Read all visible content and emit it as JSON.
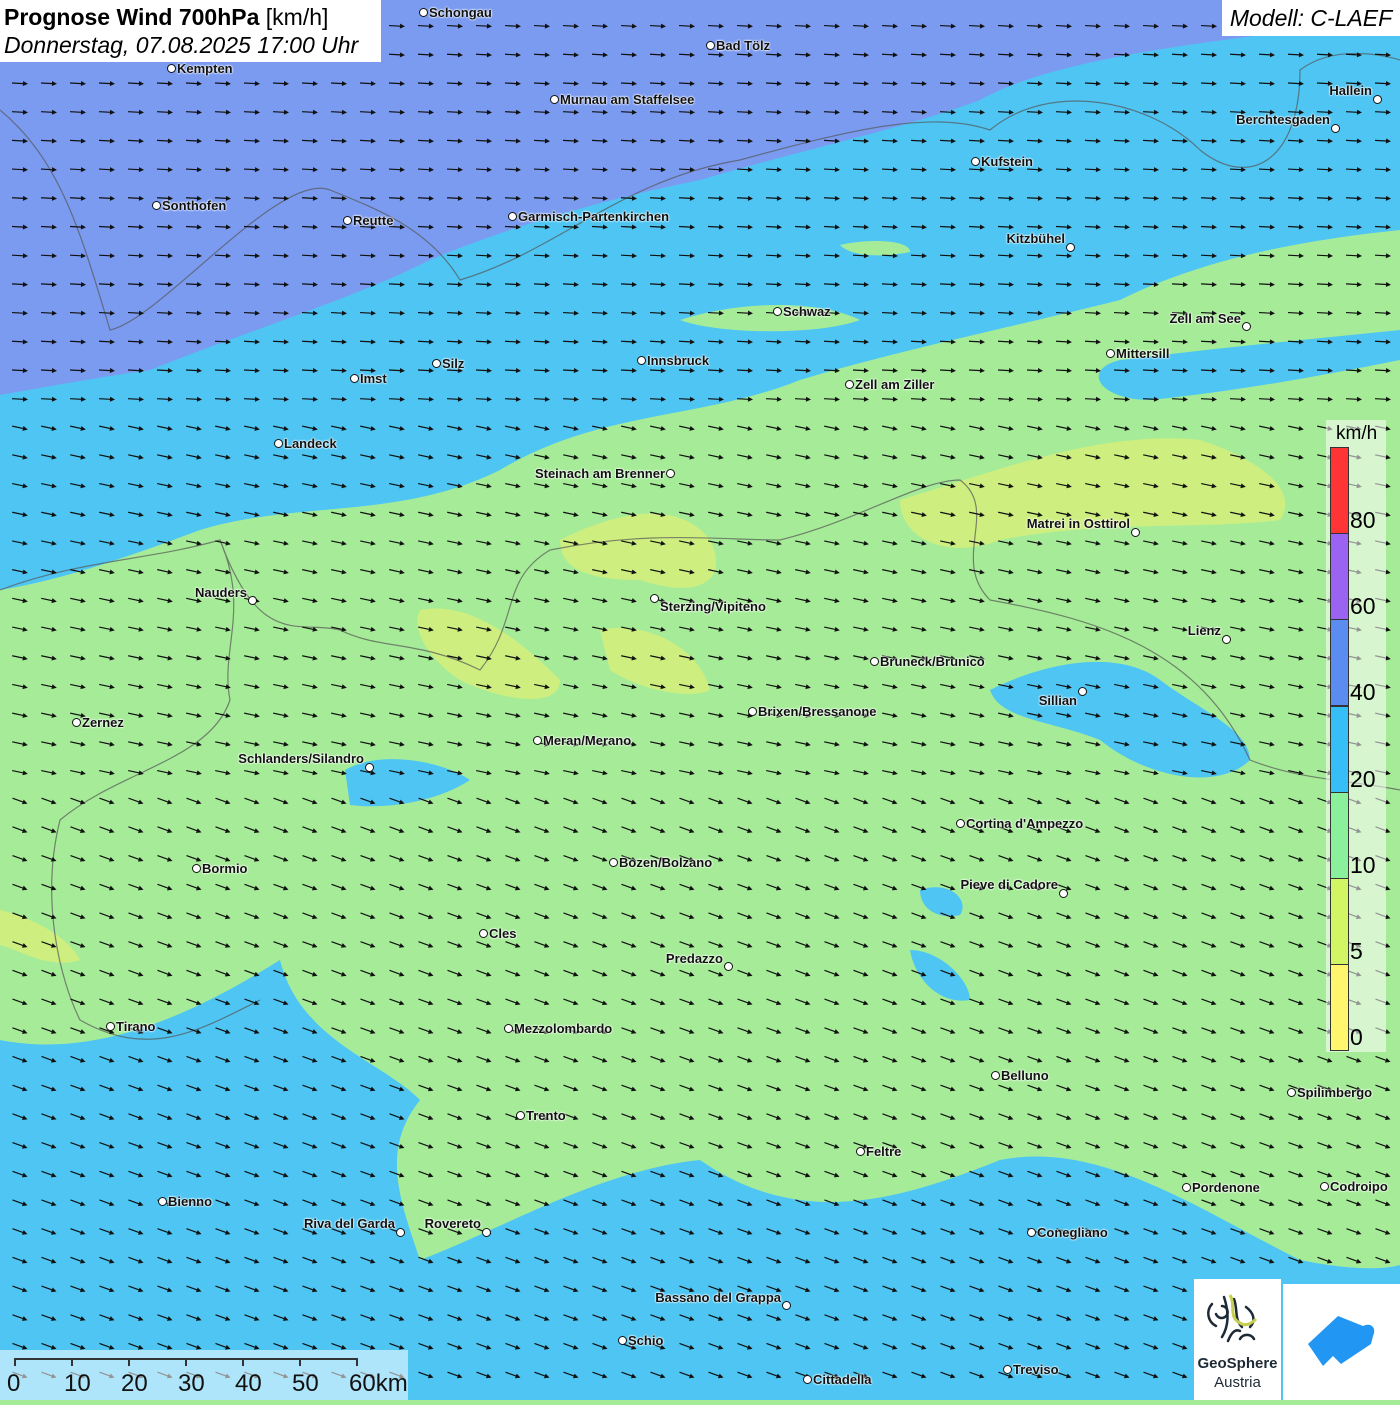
{
  "header": {
    "title_bold": "Prognose Wind 700hPa",
    "title_unit": "[km/h]",
    "datetime": "Donnerstag, 07.08.2025 17:00 Uhr",
    "model": "Modell: C-LAEF"
  },
  "legend": {
    "unit": "km/h",
    "labels": [
      "80",
      "60",
      "40",
      "20",
      "10",
      "5",
      "0"
    ],
    "colors": [
      "#ff3535",
      "#9a63f2",
      "#5b8cf0",
      "#36bff7",
      "#8af09c",
      "#d2f564",
      "#fff66e"
    ]
  },
  "scale": {
    "labels": [
      "0",
      "10",
      "20",
      "30",
      "40",
      "50",
      "60km"
    ]
  },
  "logos": {
    "geosphere_line1": "GeoSphere",
    "geosphere_line2": "Austria"
  },
  "colors": {
    "purple_zone": "#7b9bf0",
    "cyan_zone": "#4ec5f3",
    "green_zone": "#a6ec98",
    "yellow_zone": "#d3f07c"
  },
  "cities": [
    "Schongau",
    "Bad Tölz",
    "Kempten",
    "Murnau am Staffelsee",
    "Hallein",
    "Berchtesgaden",
    "Kufstein",
    "Sonthofen",
    "Reutte",
    "Garmisch-Partenkirchen",
    "Kitzbühel",
    "Schwaz",
    "Zell am See",
    "Innsbruck",
    "Mittersill",
    "Silz",
    "Imst",
    "Zell am Ziller",
    "Landeck",
    "Steinach am Brenner",
    "Matrei in Osttirol",
    "Nauders",
    "Sterzing/Vipiteno",
    "Lienz",
    "Bruneck/Brunico",
    "Sillian",
    "Brixen/Bressanone",
    "Zernez",
    "Meran/Merano",
    "Schlanders/Silandro",
    "Cortina d'Ampezzo",
    "Bozen/Bolzano",
    "Bormio",
    "Pieve di Cadore",
    "Cles",
    "Predazzo",
    "Tirano",
    "Mezzolombardo",
    "Belluno",
    "Spilimbergo",
    "Trento",
    "Feltre",
    "Pordenone",
    "Codroipo",
    "Bienno",
    "Riva del Garda",
    "Rovereto",
    "Conegliano",
    "Bassano del Grappa",
    "Schio",
    "Treviso",
    "Cittadella"
  ]
}
